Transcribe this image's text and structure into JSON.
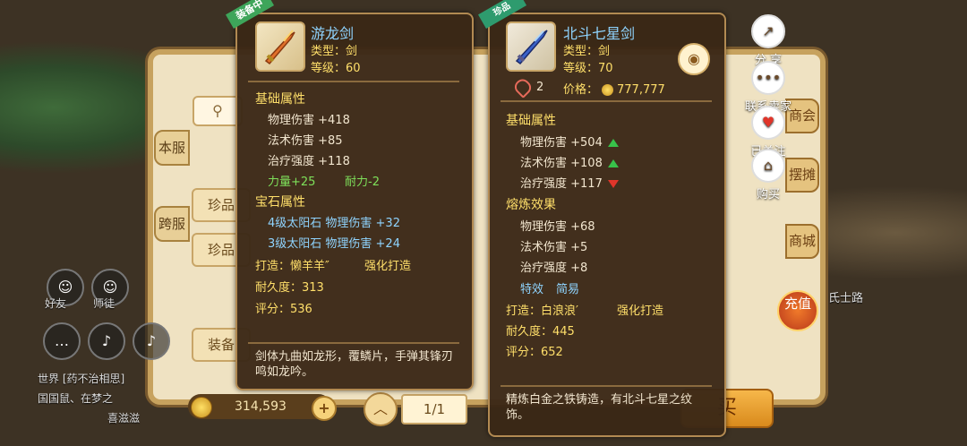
{
  "background": {
    "tabs": [
      "本服",
      "跨服"
    ],
    "search_icon": "search-icon",
    "category_buttons": [
      "珍品",
      "珍品",
      "装备"
    ],
    "coins": "314,593",
    "page": "1/1",
    "buy_label": "买",
    "vertical_tabs": [
      "商会",
      "摆摊",
      "商城"
    ],
    "recharge": "充值",
    "friend_label": "好友",
    "master_label": "师徒",
    "chat_line1": "世界 [药不治相思]",
    "chat_line2": "国国鼠、在梦之",
    "chat_line3": "喜滋滋",
    "npc_label": "氏士路"
  },
  "right_actions": [
    {
      "icon": "share-icon",
      "label": "分 享"
    },
    {
      "icon": "chat-bubble-icon",
      "label": "联系卖家"
    },
    {
      "icon": "heart-icon",
      "label": "已关注"
    },
    {
      "icon": "cart-icon",
      "label": "购买"
    }
  ],
  "equipped_item": {
    "badge": "装备中",
    "name": "游龙剑",
    "type_line": "类型：剑",
    "level_line": "等级：60",
    "base_header": "基础属性",
    "base_stats": [
      "物理伤害 +418",
      "法术伤害 +85",
      "治疗强度 +118"
    ],
    "bonus_stats": [
      "力量+25",
      "耐力-2"
    ],
    "gem_header": "宝石属性",
    "gem_stats": [
      "4级太阳石 物理伤害 +32",
      "3级太阳石 物理伤害 +24"
    ],
    "forge_label": "打造：懒羊羊″",
    "forge_type": "强化打造",
    "durability": "耐久度：313",
    "score": "评分：536",
    "description": "剑体九曲如龙形，覆鳞片，手弹其锋刃鸣如龙吟。"
  },
  "compare_item": {
    "badge": "珍品",
    "name": "北斗七星剑",
    "type_line": "类型：剑",
    "level_line": "等级：70",
    "likes": "2",
    "price_label": "价格：",
    "price": "777,777",
    "base_header": "基础属性",
    "base_stats": [
      {
        "text": "物理伤害 +504",
        "trend": "up"
      },
      {
        "text": "法术伤害 +108",
        "trend": "up"
      },
      {
        "text": "治疗强度 +117",
        "trend": "down"
      }
    ],
    "refine_header": "熔炼效果",
    "refine_stats": [
      "物理伤害 +68",
      "法术伤害 +5",
      "治疗强度 +8"
    ],
    "special_label": "特效",
    "special_value": "简易",
    "forge_label": "打造：白浪浪′",
    "forge_type": "强化打造",
    "durability": "耐久度：445",
    "score": "评分：652",
    "description": "精炼白金之铁铸造，有北斗七星之纹饰。"
  },
  "colors": {
    "gold_text": "#ffdf6a",
    "blue_text": "#8fd4ff",
    "green_text": "#7ee05a",
    "up_arrow": "#38c24a",
    "down_arrow": "#e0352a"
  }
}
